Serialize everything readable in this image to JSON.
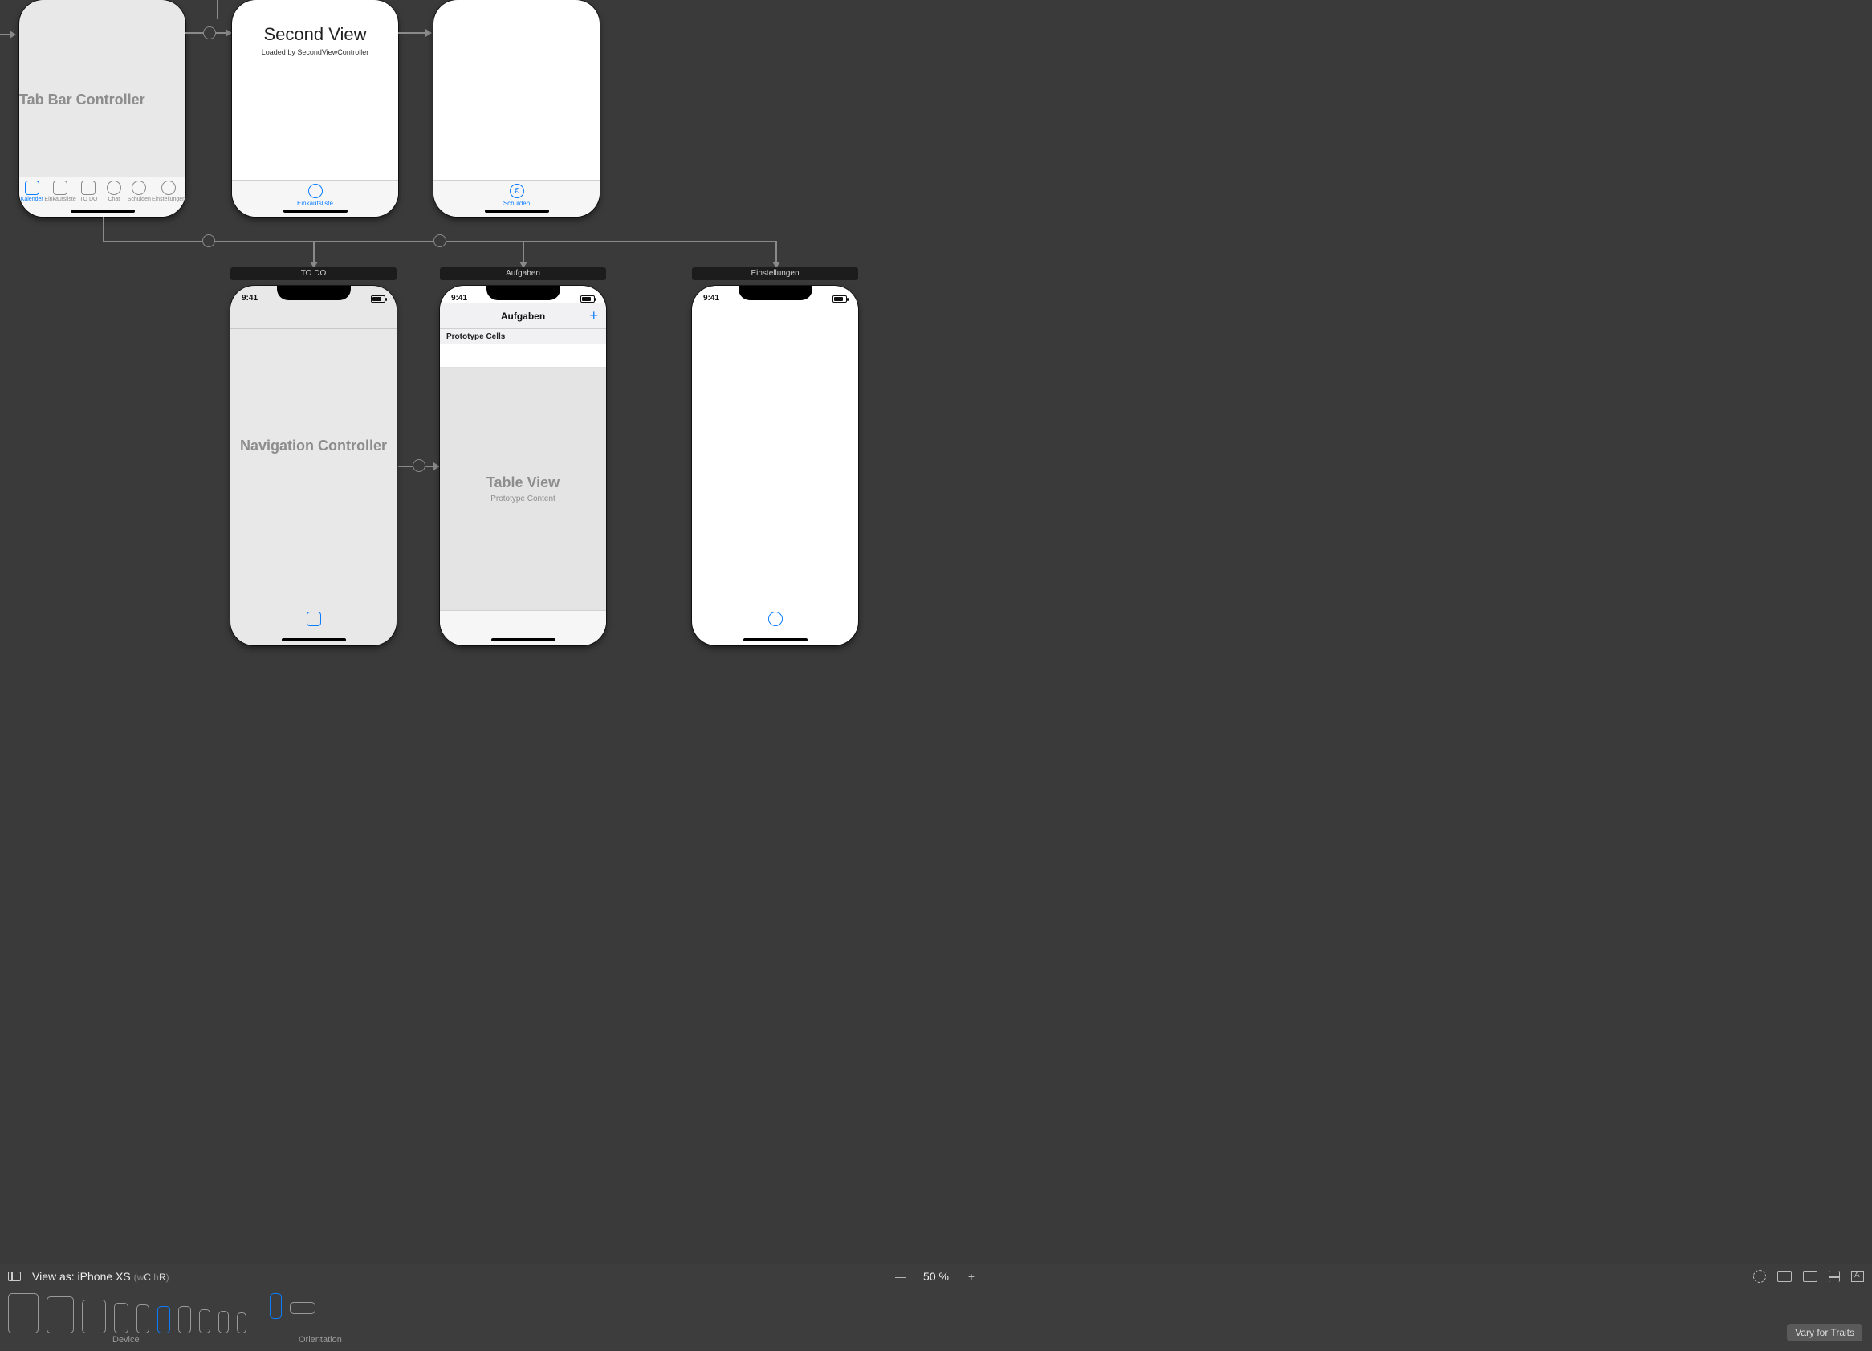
{
  "scenes": {
    "tabbarcontroller": {
      "title": "Tab Bar Controller",
      "tabs": [
        "Kalender",
        "Einkaufsliste",
        "TO DO",
        "Chat",
        "Schulden",
        "Einstellungen"
      ],
      "selected_index": 0
    },
    "secondview": {
      "title": "Second View",
      "subtitle": "Loaded by SecondViewController",
      "tab_label": "Einkaufsliste"
    },
    "schulden": {
      "tab_label": "Schulden",
      "tab_glyph": "€"
    },
    "todo_nav": {
      "bar_label": "TO DO",
      "placeholder": "Navigation Controller",
      "status_time": "9:41"
    },
    "aufgaben": {
      "bar_label": "Aufgaben",
      "nav_title": "Aufgaben",
      "plus": "+",
      "proto_header": "Prototype Cells",
      "tv_title": "Table View",
      "tv_sub": "Prototype Content",
      "status_time": "9:41"
    },
    "einstellungen": {
      "bar_label": "Einstellungen",
      "status_time": "9:41"
    }
  },
  "bottombar": {
    "view_as_label": "View as: iPhone XS",
    "size_class_w": "w",
    "size_class_wv": "C",
    "size_class_h": "h",
    "size_class_hv": "R",
    "zoom": "50 %",
    "device_label": "Device",
    "orientation_label": "Orientation",
    "vary_label": "Vary for Traits"
  }
}
